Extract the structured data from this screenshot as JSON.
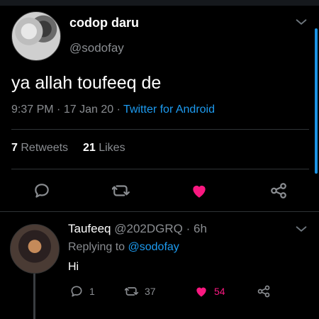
{
  "tweet": {
    "author_name": "codop daru",
    "author_handle": "@sodofay",
    "text": "ya allah toufeeq de",
    "time": "9:37 PM",
    "date": "17 Jan 20",
    "separator": "·",
    "app": "Twitter for Android",
    "retweets_count": "7",
    "retweets_label": "Retweets",
    "likes_count": "21",
    "likes_label": "Likes"
  },
  "reply": {
    "author_name": "Taufeeq",
    "author_handle": "@202DGRQ",
    "separator": "·",
    "age": "6h",
    "replying_to_label": "Replying to",
    "replying_to_handle": "@sodofay",
    "text": "Hi",
    "reply_count": "1",
    "retweet_count": "37",
    "like_count": "54"
  },
  "colors": {
    "background": "#000000",
    "accent": "#1d9bf0",
    "like": "#f91880",
    "muted": "#8a8d91"
  },
  "icons": {
    "main": [
      "chevron-down-icon",
      "reply-icon",
      "retweet-icon",
      "like-icon",
      "share-icon"
    ],
    "reply": [
      "chevron-down-icon",
      "reply-icon",
      "retweet-icon",
      "like-icon",
      "share-icon"
    ]
  }
}
